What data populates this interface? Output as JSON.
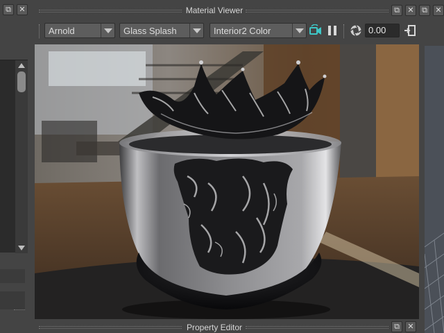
{
  "material_viewer": {
    "title": "Material Viewer",
    "renderer": "Arnold",
    "shader_ball": "Glass Splash",
    "environment": "Interior2 Color",
    "exposure_value": "0.00",
    "icons": [
      "render-camera-icon",
      "pause-icon",
      "exposure-icon",
      "snapshot-icon"
    ]
  },
  "property_editor": {
    "title": "Property Editor"
  },
  "window_controls": {
    "float_symbol": "⧉",
    "close_symbol": "✕"
  },
  "colors": {
    "panel_bg": "#444444",
    "field_bg": "#2b2b2b",
    "dropdown_bg": "#5d5d5d",
    "accent_teal": "#3ec7c7"
  }
}
